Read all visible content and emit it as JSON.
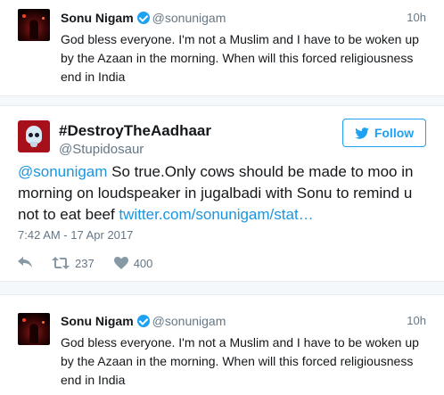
{
  "quoted_tweet": {
    "name": "Sonu Nigam",
    "handle": "@sonunigam",
    "time": "10h",
    "text": "God bless everyone. I'm not a Muslim and I have to be woken up by the Azaan in the morning. When will this forced religiousness end in India"
  },
  "main_tweet": {
    "name": "#DestroyTheAadhaar",
    "handle": "@Stupidosaur",
    "follow_label": "Follow",
    "mention": "@sonunigam",
    "text_body": " So true.Only cows should be made to moo in morning on loudspeaker in jugalbadi with Sonu to remind u not to eat beef ",
    "link_text": "twitter.com/sonunigam/stat…",
    "date": "7:42 AM - 17 Apr 2017",
    "retweet_count": "237",
    "like_count": "400"
  },
  "icons": {
    "verified": "verified-badge-icon",
    "follow": "twitter-bird-icon",
    "reply": "reply-icon",
    "retweet": "retweet-icon",
    "like": "heart-icon"
  },
  "colors": {
    "accent": "#1da1f2",
    "link": "#1b95e0",
    "muted": "#657786",
    "background": "#f5f8fa"
  }
}
